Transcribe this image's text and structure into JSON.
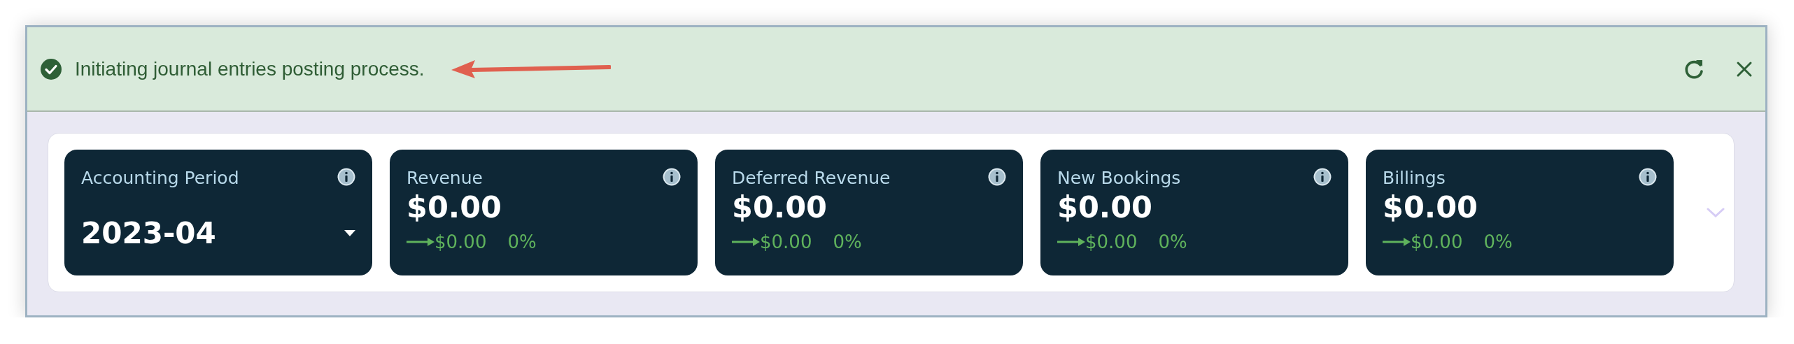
{
  "alert": {
    "message": "Initiating journal entries posting process.",
    "kind": "success"
  },
  "cards": [
    {
      "kind": "period",
      "title": "Accounting Period",
      "value": "2023-04"
    },
    {
      "kind": "metric",
      "title": "Revenue",
      "value": "$0.00",
      "delta": "$0.00",
      "percent": "0%"
    },
    {
      "kind": "metric",
      "title": "Deferred Revenue",
      "value": "$0.00",
      "delta": "$0.00",
      "percent": "0%"
    },
    {
      "kind": "metric",
      "title": "New Bookings",
      "value": "$0.00",
      "delta": "$0.00",
      "percent": "0%"
    },
    {
      "kind": "metric",
      "title": "Billings",
      "value": "$0.00",
      "delta": "$0.00",
      "percent": "0%"
    }
  ]
}
